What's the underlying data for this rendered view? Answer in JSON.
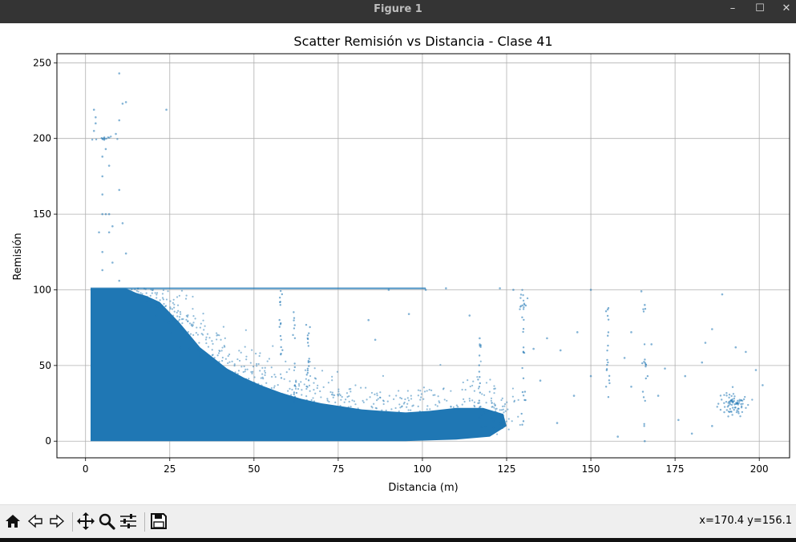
{
  "window": {
    "title": "Figure 1",
    "controls": {
      "minimize": "–",
      "maximize": "☐",
      "close": "✕"
    }
  },
  "toolbar": {
    "buttons": [
      {
        "name": "home-button",
        "icon": "home-icon"
      },
      {
        "name": "back-button",
        "icon": "arrow-left-icon"
      },
      {
        "name": "forward-button",
        "icon": "arrow-right-icon"
      },
      {
        "name": "pan-button",
        "icon": "move-icon"
      },
      {
        "name": "zoom-button",
        "icon": "magnifier-icon"
      },
      {
        "name": "configure-subplots-button",
        "icon": "sliders-icon"
      },
      {
        "name": "save-button",
        "icon": "floppy-icon"
      }
    ],
    "coordinates": "x=170.4 y=156.1"
  },
  "chart_data": {
    "type": "scatter",
    "title": "Scatter Remisión vs Distancia - Clase 41",
    "xlabel": "Distancia (m)",
    "ylabel": "Remisión",
    "xlim": [
      -8.5,
      209
    ],
    "ylim": [
      -11,
      256
    ],
    "xticks": [
      0,
      25,
      50,
      75,
      100,
      125,
      150,
      175,
      200
    ],
    "yticks": [
      0,
      50,
      100,
      150,
      200,
      250
    ],
    "grid": true,
    "color": "#1f77b4",
    "dense_region": [
      [
        1.5,
        0
      ],
      [
        1.5,
        101
      ],
      [
        12,
        101
      ],
      [
        15,
        98
      ],
      [
        18,
        96
      ],
      [
        22,
        92
      ],
      [
        25,
        85
      ],
      [
        28,
        78
      ],
      [
        31,
        70
      ],
      [
        34,
        62
      ],
      [
        38,
        55
      ],
      [
        42,
        48
      ],
      [
        47,
        42
      ],
      [
        52,
        37
      ],
      [
        58,
        32
      ],
      [
        64,
        28
      ],
      [
        70,
        25
      ],
      [
        76,
        23
      ],
      [
        82,
        21
      ],
      [
        88,
        20
      ],
      [
        95,
        19
      ],
      [
        102,
        20
      ],
      [
        110,
        22
      ],
      [
        118,
        22
      ],
      [
        124,
        18
      ],
      [
        125,
        10
      ],
      [
        120,
        3
      ],
      [
        110,
        1
      ],
      [
        95,
        0
      ],
      [
        1.5,
        0
      ]
    ],
    "clusters": [
      {
        "cx": 192,
        "cy": 24,
        "sx": 2,
        "sy": 4,
        "n": 80
      },
      {
        "cx": 130,
        "cy": 92,
        "sx": 0.5,
        "sy": 4,
        "n": 15
      },
      {
        "cx": 6,
        "cy": 200,
        "sx": 1.5,
        "sy": 1,
        "n": 14
      }
    ],
    "sparse_points": [
      [
        10,
        243
      ],
      [
        11,
        223
      ],
      [
        12,
        224
      ],
      [
        24,
        219
      ],
      [
        2.5,
        219
      ],
      [
        3,
        214
      ],
      [
        3,
        210
      ],
      [
        2.5,
        205
      ],
      [
        9,
        203
      ],
      [
        10,
        212
      ],
      [
        6,
        193
      ],
      [
        5,
        188
      ],
      [
        5,
        175
      ],
      [
        7,
        182
      ],
      [
        5,
        163
      ],
      [
        10,
        166
      ],
      [
        5,
        150
      ],
      [
        6,
        150
      ],
      [
        7,
        150
      ],
      [
        4,
        138
      ],
      [
        7,
        138
      ],
      [
        8,
        142
      ],
      [
        11,
        144
      ],
      [
        5,
        125
      ],
      [
        5,
        113
      ],
      [
        12,
        124
      ],
      [
        10,
        106
      ],
      [
        8,
        118
      ],
      [
        201,
        37
      ],
      [
        199,
        47
      ],
      [
        196,
        59
      ],
      [
        193,
        62
      ],
      [
        189,
        97
      ],
      [
        186,
        74
      ],
      [
        184,
        65
      ],
      [
        183,
        52
      ],
      [
        178,
        43
      ],
      [
        172,
        48
      ],
      [
        168,
        64
      ],
      [
        166,
        90
      ],
      [
        165,
        99
      ],
      [
        162,
        72
      ],
      [
        160,
        55
      ],
      [
        155,
        87
      ],
      [
        150,
        100
      ],
      [
        146,
        72
      ],
      [
        141,
        60
      ],
      [
        137,
        68
      ],
      [
        133,
        61
      ],
      [
        127,
        100
      ],
      [
        123,
        101
      ],
      [
        117,
        68
      ],
      [
        114,
        83
      ],
      [
        107,
        101
      ],
      [
        101,
        100
      ],
      [
        96,
        84
      ],
      [
        90,
        100
      ],
      [
        86,
        67
      ],
      [
        84,
        80
      ],
      [
        150,
        43
      ],
      [
        145,
        30
      ],
      [
        135,
        40
      ],
      [
        140,
        12
      ],
      [
        158,
        3
      ],
      [
        166,
        0
      ],
      [
        180,
        5
      ],
      [
        176,
        14
      ],
      [
        186,
        10
      ],
      [
        170,
        30
      ],
      [
        162,
        36
      ]
    ],
    "stripes": [
      {
        "x": 58,
        "y0": 28,
        "y1": 101
      },
      {
        "x": 62,
        "y0": 22,
        "y1": 88
      },
      {
        "x": 66,
        "y0": 35,
        "y1": 78
      },
      {
        "x": 130,
        "y0": 8,
        "y1": 95
      },
      {
        "x": 117,
        "y0": 10,
        "y1": 70
      },
      {
        "x": 155,
        "y0": 20,
        "y1": 90
      },
      {
        "x": 166,
        "y0": 10,
        "y1": 92
      }
    ],
    "cap_line": {
      "x0": 1.5,
      "x1": 101,
      "y": 101
    }
  }
}
